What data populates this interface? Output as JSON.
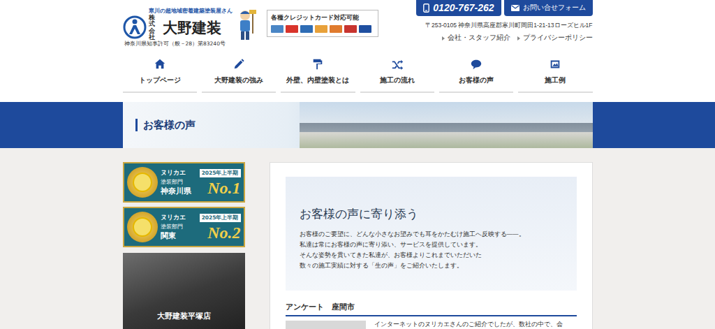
{
  "header": {
    "tagline": "寒川の超地域密着建築塗装屋さん",
    "company_type": "株式会社",
    "company_name": "大野建装",
    "license": "神奈川県知事許可（般－28）第83240号",
    "cards_title": "各種クレジットカード対応可能",
    "cards": [
      {
        "color": "#4a86c5"
      },
      {
        "color": "#d9342b"
      },
      {
        "color": "#2f6db5"
      },
      {
        "color": "#e8a13a"
      },
      {
        "color": "#e07b2e"
      },
      {
        "color": "#c8342f"
      },
      {
        "color": "#1f4fa0"
      }
    ],
    "phone": "0120-767-262",
    "contact": "お問い合せフォーム",
    "address": "〒253-0105 神奈川県高座郡寒川町岡田1-21-13ローズヒル1F",
    "links": [
      "会社・スタッフ紹介",
      "プライバシーポリシー"
    ]
  },
  "nav": [
    {
      "label": "トップページ",
      "selected": false
    },
    {
      "label": "大野建装の強み",
      "selected": false
    },
    {
      "label": "外壁、内壁塗装とは",
      "selected": false
    },
    {
      "label": "施工の流れ",
      "selected": false
    },
    {
      "label": "お客様の声",
      "selected": false
    },
    {
      "label": "施工例",
      "selected": false
    }
  ],
  "banner": {
    "title": "お客様の声"
  },
  "sidebar": {
    "awards": [
      {
        "brand": "ヌリカエ",
        "period": "2025年上半期",
        "category": "塗装部門",
        "region": "神奈川県",
        "rank": "No.1"
      },
      {
        "brand": "ヌリカエ",
        "period": "2025年上半期",
        "category": "塗装部門",
        "region": "関東",
        "rank": "No.2"
      }
    ],
    "store": {
      "caption": "大野建装平塚店"
    }
  },
  "intro": {
    "title": "お客様の声に寄り添う",
    "lines": [
      "お客様のご要望に、どんな小さなお望みでも耳をかたむけ施工へ反映する――。",
      "私達は常にお客様の声に寄り添い、サービスを提供しています。",
      "そんな姿勢を貫いてきた私達が、お客様よりこれまでいただいた",
      "数々の施工実績に対する「生の声」をご紹介いたします。"
    ]
  },
  "review": {
    "heading": "アンケート　座間市",
    "text": "インターネットのヌリカエさんのご紹介でしたが、数社の中で、会"
  }
}
